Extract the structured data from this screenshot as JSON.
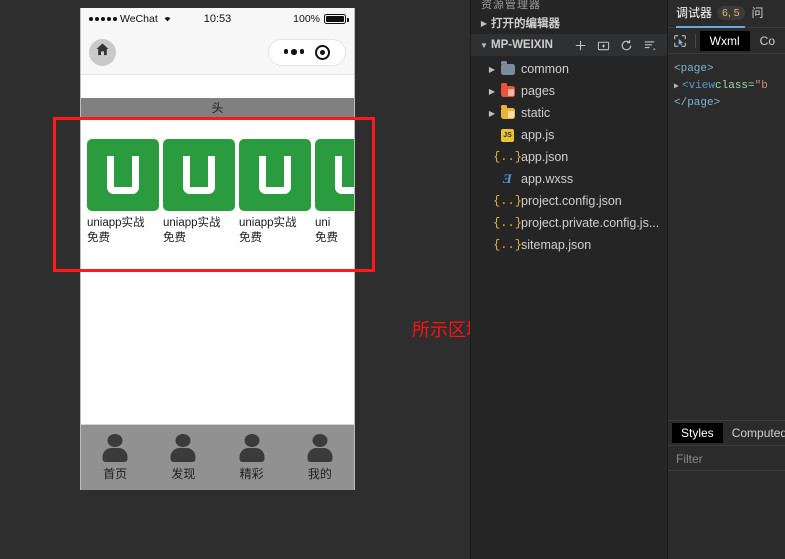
{
  "simulator": {
    "status_bar": {
      "carrier": "WeChat",
      "time": "10:53",
      "battery": "100%",
      "signal_icon": "signal-dots-icon",
      "wifi_icon": "wifi-icon",
      "battery_icon": "battery-full-icon"
    },
    "nav_bar": {
      "home_icon": "home-icon",
      "menu_icon": "more-dots-icon",
      "target_icon": "target-circle-icon"
    },
    "header_band": {
      "text": "头"
    },
    "cards": [
      {
        "title": "uniapp实战",
        "subtitle": "免费",
        "thumb_icon": "uni-logo-icon"
      },
      {
        "title": "uniapp实战",
        "subtitle": "免费",
        "thumb_icon": "uni-logo-icon"
      },
      {
        "title": "uniapp实战",
        "subtitle": "免费",
        "thumb_icon": "uni-logo-icon"
      },
      {
        "title": "uni",
        "subtitle": "免费",
        "thumb_icon": "uni-logo-icon"
      }
    ],
    "tab_bar": [
      {
        "label": "首页",
        "icon": "person-icon"
      },
      {
        "label": "发现",
        "icon": "person-icon"
      },
      {
        "label": "精彩",
        "icon": "person-icon"
      },
      {
        "label": "我的",
        "icon": "person-icon"
      }
    ],
    "annotation": {
      "note": "所示区域可以实现左右滑动",
      "color": "#fd1313"
    }
  },
  "explorer": {
    "title": "资源管理器",
    "open_editors": {
      "label": "打开的编辑器",
      "chevron": "chevron-right-icon"
    },
    "project": {
      "label": "MP-WEIXIN",
      "chevron": "chevron-down-icon"
    },
    "toolbar": [
      {
        "name": "new-file-icon",
        "glyph": "＋"
      },
      {
        "name": "new-folder-icon",
        "glyph": "▣"
      },
      {
        "name": "refresh-icon",
        "glyph": "⟳"
      },
      {
        "name": "collapse-all-icon",
        "glyph": "≡"
      }
    ],
    "tree": [
      {
        "name": "common",
        "kind": "folder",
        "color": "gray",
        "expandable": true
      },
      {
        "name": "pages",
        "kind": "folder",
        "color": "red",
        "expandable": true
      },
      {
        "name": "static",
        "kind": "folder",
        "color": "yellow",
        "expandable": true
      },
      {
        "name": "app.js",
        "kind": "js",
        "expandable": false
      },
      {
        "name": "app.json",
        "kind": "json",
        "expandable": false
      },
      {
        "name": "app.wxss",
        "kind": "css",
        "expandable": false
      },
      {
        "name": "project.config.json",
        "kind": "json",
        "expandable": false
      },
      {
        "name": "project.private.config.js...",
        "kind": "json",
        "expandable": false
      },
      {
        "name": "sitemap.json",
        "kind": "json",
        "expandable": false
      }
    ]
  },
  "debugger": {
    "tabs": [
      {
        "label": "调试器",
        "badge": "6, 5",
        "active": true
      },
      {
        "label": "问",
        "badge": "",
        "active": false
      }
    ],
    "inspect_icon": "inspect-element-icon",
    "subtabs": [
      {
        "label": "Wxml",
        "active": true
      },
      {
        "label": "Co",
        "active": false
      }
    ],
    "code": {
      "line1_open": "<page>",
      "line2_arrow": "▸",
      "line2_tag": "<view ",
      "line2_attr": "class=",
      "line2_val": "\"b",
      "line3_close": "</page>"
    },
    "styles_tabs": [
      {
        "label": "Styles",
        "active": true
      },
      {
        "label": "Computed",
        "active": false
      }
    ],
    "filter_placeholder": "Filter"
  }
}
